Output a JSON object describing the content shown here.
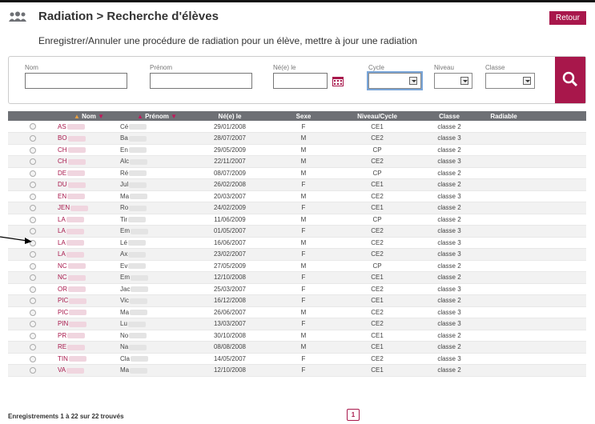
{
  "header": {
    "title": "Radiation > Recherche d'élèves",
    "subtitle": "Enregistrer/Annuler une procédure de radiation pour un élève, mettre à jour une radiation",
    "back_label": "Retour"
  },
  "filters": {
    "nom_label": "Nom",
    "prenom_label": "Prénom",
    "dob_label": "Né(e) le",
    "cycle_label": "Cycle",
    "niveau_label": "Niveau",
    "classe_label": "Classe"
  },
  "table": {
    "headers": [
      "Nom",
      "Prénom",
      "Né(e) le",
      "Sexe",
      "Niveau/Cycle",
      "Classe",
      "Radiable"
    ],
    "rows": [
      {
        "nom": "AS",
        "prenom": "Cé",
        "dob": "29/01/2008",
        "sexe": "F",
        "niveau": "CE1",
        "classe": "classe 2"
      },
      {
        "nom": "BO",
        "prenom": "Ba",
        "dob": "28/07/2007",
        "sexe": "M",
        "niveau": "CE2",
        "classe": "classe 3"
      },
      {
        "nom": "CH",
        "prenom": "En",
        "dob": "29/05/2009",
        "sexe": "M",
        "niveau": "CP",
        "classe": "classe 2"
      },
      {
        "nom": "CH",
        "prenom": "Alc",
        "dob": "22/11/2007",
        "sexe": "M",
        "niveau": "CE2",
        "classe": "classe 3"
      },
      {
        "nom": "DE",
        "prenom": "Ré",
        "dob": "08/07/2009",
        "sexe": "M",
        "niveau": "CP",
        "classe": "classe 2"
      },
      {
        "nom": "DU",
        "prenom": "Jul",
        "dob": "26/02/2008",
        "sexe": "F",
        "niveau": "CE1",
        "classe": "classe 2"
      },
      {
        "nom": "EN",
        "prenom": "Ma",
        "dob": "20/03/2007",
        "sexe": "M",
        "niveau": "CE2",
        "classe": "classe 3"
      },
      {
        "nom": "JEN",
        "prenom": "Ro",
        "dob": "24/02/2009",
        "sexe": "F",
        "niveau": "CE1",
        "classe": "classe 2"
      },
      {
        "nom": "LA",
        "prenom": "Tir",
        "dob": "11/06/2009",
        "sexe": "M",
        "niveau": "CP",
        "classe": "classe 2"
      },
      {
        "nom": "LA",
        "prenom": "Em",
        "dob": "01/05/2007",
        "sexe": "F",
        "niveau": "CE2",
        "classe": "classe 3"
      },
      {
        "nom": "LA",
        "prenom": "Lé",
        "dob": "16/06/2007",
        "sexe": "M",
        "niveau": "CE2",
        "classe": "classe 3"
      },
      {
        "nom": "LA",
        "prenom": "Ax",
        "dob": "23/02/2007",
        "sexe": "F",
        "niveau": "CE2",
        "classe": "classe 3"
      },
      {
        "nom": "NC",
        "prenom": "Ev",
        "dob": "27/05/2009",
        "sexe": "M",
        "niveau": "CP",
        "classe": "classe 2"
      },
      {
        "nom": "NC",
        "prenom": "Em",
        "dob": "12/10/2008",
        "sexe": "F",
        "niveau": "CE1",
        "classe": "classe 2"
      },
      {
        "nom": "OR",
        "prenom": "Jac",
        "dob": "25/03/2007",
        "sexe": "F",
        "niveau": "CE2",
        "classe": "classe 3"
      },
      {
        "nom": "PIC",
        "prenom": "Vic",
        "dob": "16/12/2008",
        "sexe": "F",
        "niveau": "CE1",
        "classe": "classe 2"
      },
      {
        "nom": "PIC",
        "prenom": "Ma",
        "dob": "26/06/2007",
        "sexe": "M",
        "niveau": "CE2",
        "classe": "classe 3"
      },
      {
        "nom": "PIN",
        "prenom": "Lu",
        "dob": "13/03/2007",
        "sexe": "F",
        "niveau": "CE2",
        "classe": "classe 3"
      },
      {
        "nom": "PR",
        "prenom": "No",
        "dob": "30/10/2008",
        "sexe": "M",
        "niveau": "CE1",
        "classe": "classe 2"
      },
      {
        "nom": "RE",
        "prenom": "Na",
        "dob": "08/08/2008",
        "sexe": "M",
        "niveau": "CE1",
        "classe": "classe 2"
      },
      {
        "nom": "TIN",
        "prenom": "Cla",
        "dob": "14/05/2007",
        "sexe": "F",
        "niveau": "CE2",
        "classe": "classe 3"
      },
      {
        "nom": "VA",
        "prenom": "Ma",
        "dob": "12/10/2008",
        "sexe": "F",
        "niveau": "CE1",
        "classe": "classe 2"
      }
    ]
  },
  "footer": {
    "records_text": "Enregistrements 1 à 22 sur 22 trouvés",
    "page": "1"
  },
  "colors": {
    "accent": "#a8174b",
    "table_header": "#6e7075"
  }
}
